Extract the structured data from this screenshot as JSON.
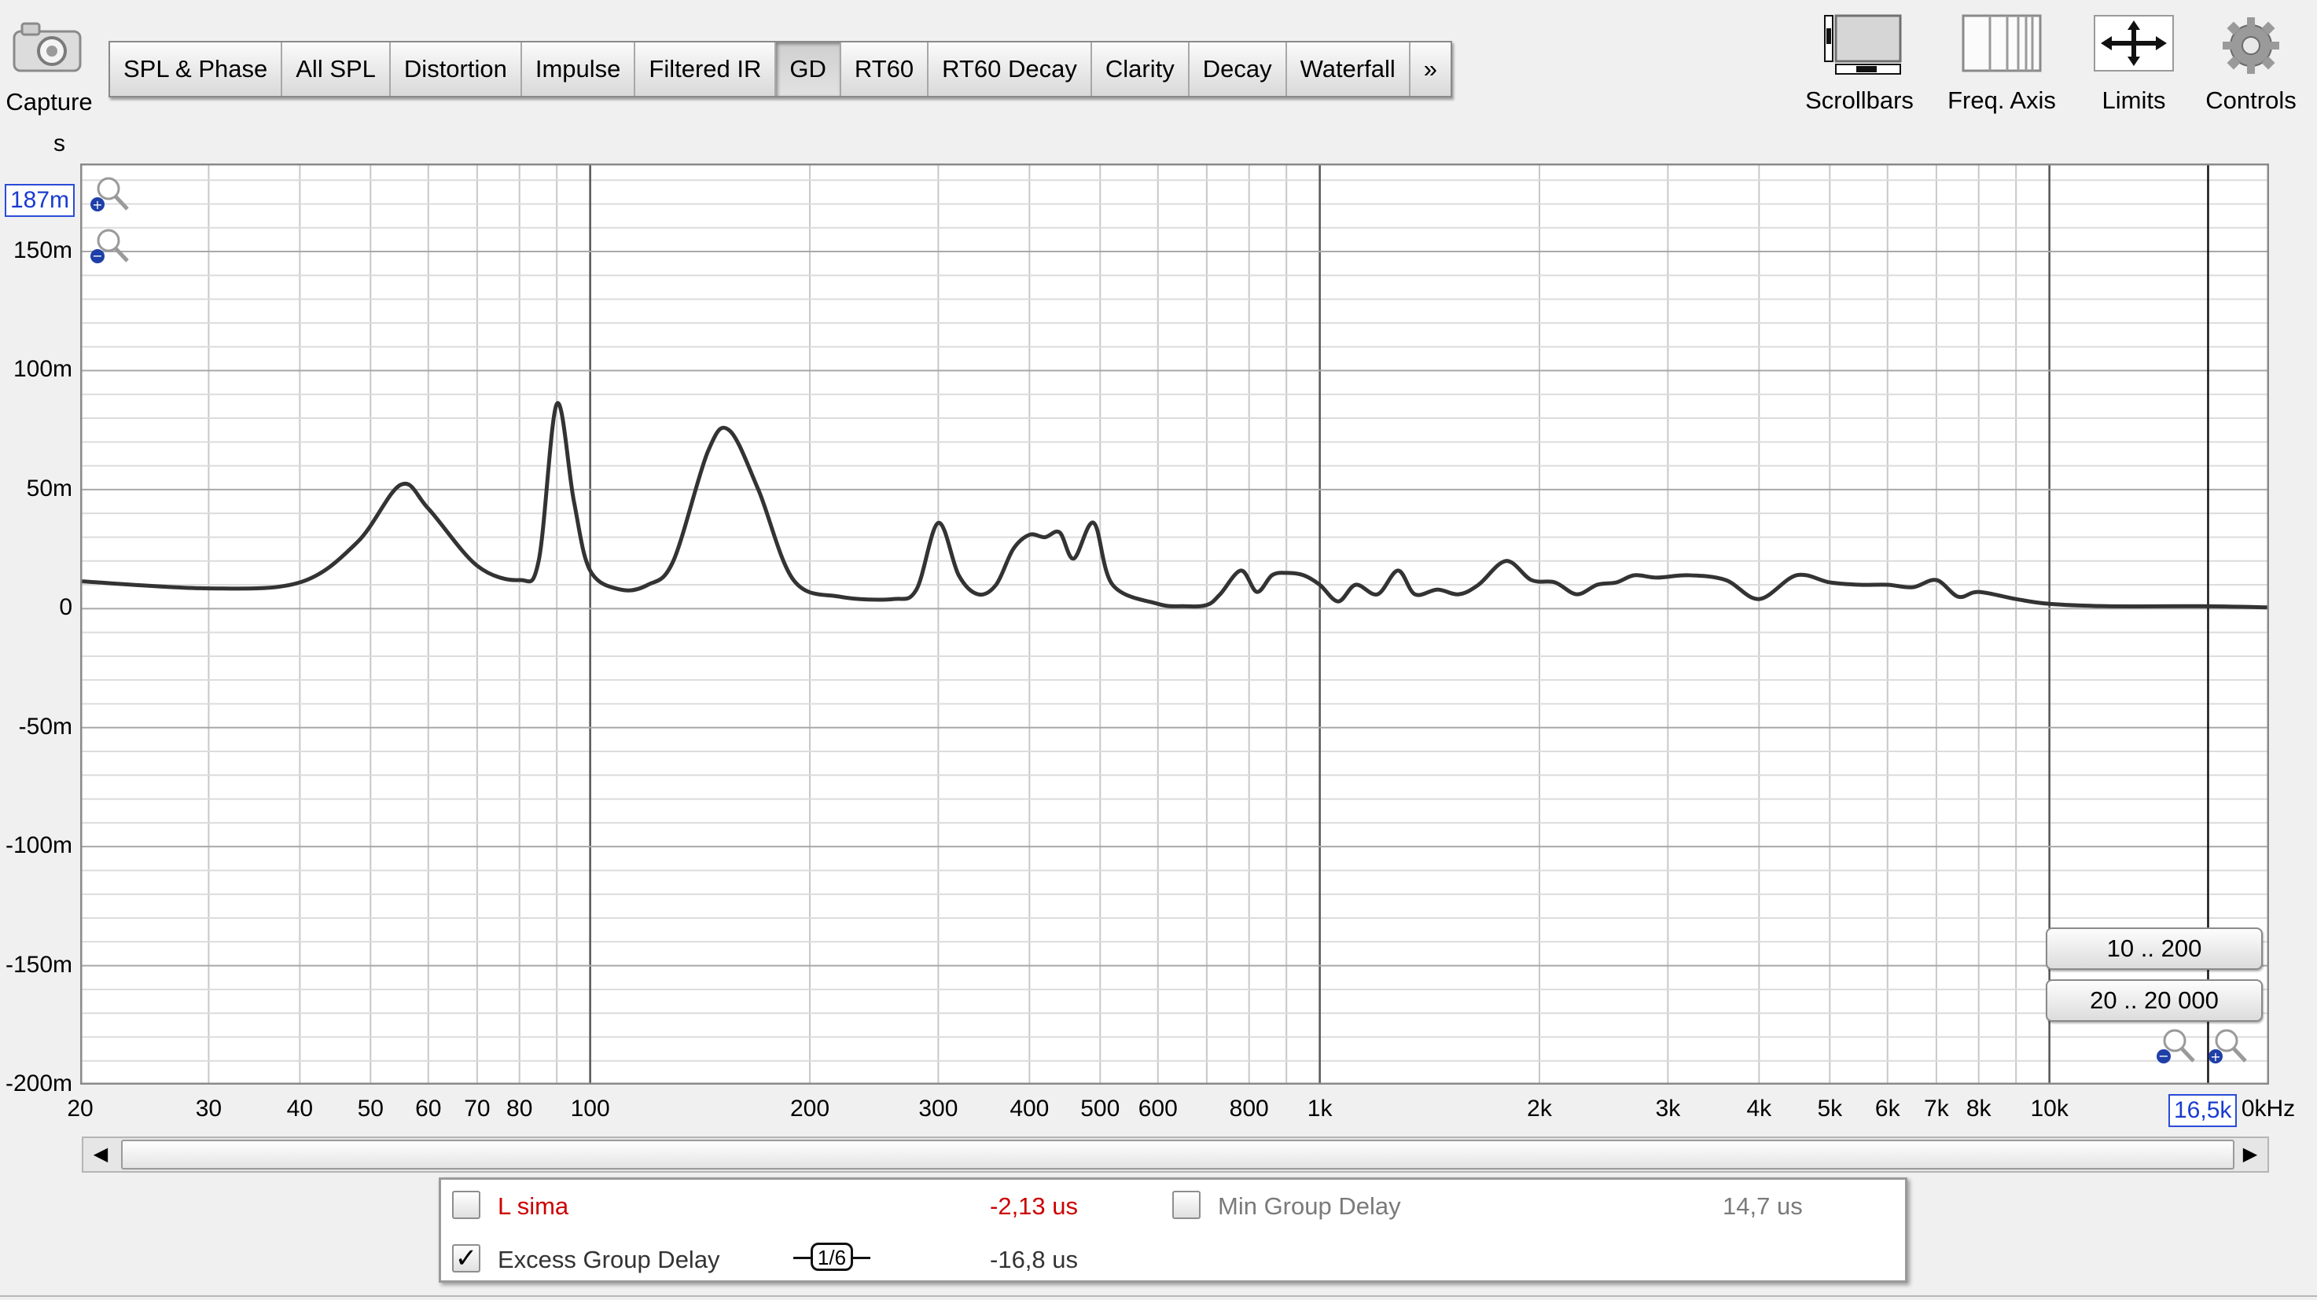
{
  "capture": {
    "label": "Capture",
    "icon": "camera-icon"
  },
  "tabs": [
    {
      "label": "SPL & Phase",
      "active": false
    },
    {
      "label": "All SPL",
      "active": false
    },
    {
      "label": "Distortion",
      "active": false
    },
    {
      "label": "Impulse",
      "active": false
    },
    {
      "label": "Filtered IR",
      "active": false
    },
    {
      "label": "GD",
      "active": true
    },
    {
      "label": "RT60",
      "active": false
    },
    {
      "label": "RT60 Decay",
      "active": false
    },
    {
      "label": "Clarity",
      "active": false
    },
    {
      "label": "Decay",
      "active": false
    },
    {
      "label": "Waterfall",
      "active": false
    },
    {
      "label": "»",
      "active": false
    }
  ],
  "toolbar": {
    "scrollbars": "Scrollbars",
    "freq_axis": "Freq. Axis",
    "limits": "Limits",
    "controls": "Controls"
  },
  "plot": {
    "y_unit": "s",
    "y_cursor_value": "187m",
    "y_ticks": [
      "150m",
      "100m",
      "50m",
      "0",
      "-50m",
      "-100m",
      "-150m",
      "-200m"
    ],
    "x_ticks": [
      "20",
      "30",
      "40",
      "50",
      "60",
      "70",
      "80",
      "100",
      "200",
      "300",
      "400",
      "500",
      "600",
      "800",
      "1k",
      "2k",
      "3k",
      "4k",
      "5k",
      "6k",
      "7k",
      "8k",
      "10k"
    ],
    "x_cursor_value": "16,5k",
    "x_unit_fragment": "0kHz",
    "range_buttons": [
      "10 .. 200",
      "20 .. 20 000"
    ]
  },
  "chart_data": {
    "type": "line",
    "xlabel": "",
    "ylabel": "s",
    "x_scale": "log",
    "xlim": [
      20,
      20000
    ],
    "ylim": [
      -0.2,
      0.187
    ],
    "grid": true,
    "cursor": {
      "x": 16500,
      "y": 0.187
    },
    "series": [
      {
        "name": "Excess Group Delay",
        "color": "#333333",
        "x": [
          20,
          30,
          40,
          48,
          55,
          60,
          70,
          80,
          85,
          90,
          95,
          100,
          110,
          120,
          130,
          145,
          155,
          170,
          190,
          220,
          260,
          280,
          300,
          320,
          340,
          360,
          380,
          400,
          420,
          440,
          460,
          490,
          520,
          600,
          650,
          700,
          730,
          780,
          820,
          860,
          900,
          950,
          1000,
          1060,
          1120,
          1200,
          1280,
          1350,
          1450,
          1550,
          1650,
          1800,
          1950,
          2100,
          2250,
          2400,
          2550,
          2700,
          2900,
          3200,
          3600,
          4000,
          4500,
          5000,
          5500,
          6000,
          6500,
          7000,
          7500,
          8000,
          9000,
          10000,
          12000,
          16000,
          20000
        ],
        "y": [
          0.0115,
          0.0085,
          0.011,
          0.028,
          0.052,
          0.042,
          0.018,
          0.012,
          0.02,
          0.086,
          0.045,
          0.016,
          0.008,
          0.01,
          0.02,
          0.066,
          0.075,
          0.05,
          0.012,
          0.005,
          0.004,
          0.008,
          0.036,
          0.014,
          0.006,
          0.01,
          0.025,
          0.031,
          0.03,
          0.032,
          0.021,
          0.036,
          0.01,
          0.002,
          0.001,
          0.0015,
          0.006,
          0.016,
          0.007,
          0.014,
          0.015,
          0.014,
          0.01,
          0.003,
          0.01,
          0.006,
          0.016,
          0.006,
          0.008,
          0.006,
          0.01,
          0.02,
          0.012,
          0.011,
          0.006,
          0.01,
          0.011,
          0.014,
          0.013,
          0.014,
          0.012,
          0.004,
          0.014,
          0.011,
          0.01,
          0.01,
          0.009,
          0.012,
          0.005,
          0.007,
          0.004,
          0.002,
          0.001,
          0.001,
          0.0005
        ]
      }
    ]
  },
  "legend": {
    "rows": [
      {
        "checked": false,
        "name": "L sima",
        "value": "-2,13 us",
        "color": "#cc0000"
      },
      {
        "checked": true,
        "name": "Excess Group Delay",
        "value": "-16,8 us",
        "color": "#333333"
      }
    ],
    "min_group_delay": {
      "checked": false,
      "name": "Min Group Delay",
      "value": "14,7 us"
    },
    "smoothing": "1/6"
  },
  "colors": {
    "background": "#f0f0f0",
    "plot_bg": "#ffffff",
    "grid_major": "#555555",
    "grid_minor": "#c8c8c8",
    "cursor_box": "#2a4bd8",
    "trace": "#333333",
    "ls_label": "#cc0000"
  }
}
